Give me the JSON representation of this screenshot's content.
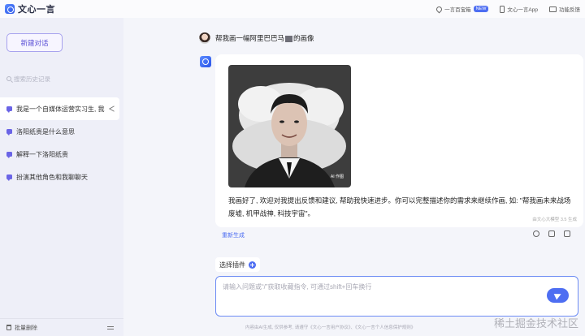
{
  "app": {
    "brand": "文心一言",
    "top_links": [
      {
        "label": "一言百宝箱",
        "badge": "NEW"
      },
      {
        "label": "文心一言App"
      },
      {
        "label": "功能反馈"
      }
    ]
  },
  "sidebar": {
    "new_chat_label": "新建对话",
    "search_placeholder": "搜索历史记录",
    "items": [
      {
        "label": "我是一个自媒体运营实习生, 我"
      },
      {
        "label": "洛阳纸贵是什么意思"
      },
      {
        "label": "解释一下洛阳纸贵"
      },
      {
        "label": "扮演其他角色和我聊聊天"
      }
    ],
    "bulk_delete_label": "批量删除"
  },
  "conversation": {
    "user_prompt_before": "帮我画一幅阿里巴巴马",
    "user_prompt_after": "的画像",
    "image_tag": "AI 作图",
    "reply_text": "我画好了, 欢迎对我提出反馈和建议, 帮助我快速进步。你可以完整描述你的需求来继续作画, 如: \"帮我画未来战场废墟, 机甲战神, 科技宇宙\"。",
    "card_footer": "由文心大模型 3.5 生成",
    "regenerate_label": "重新生成"
  },
  "composer": {
    "plugin_label": "选择插件",
    "placeholder": "请输入问题或“/”获取收藏指令, 可通过shift+回车换行"
  },
  "footer": {
    "disclaimer": "内容由AI生成, 仅供参考, 请遵守《文心一言用户协议》、《文心一言个人信息保护规则》",
    "watermark": "稀土掘金技术社区"
  },
  "colors": {
    "accent": "#4e6ef2",
    "sidebar_bg": "#eeeff8",
    "main_bg": "#f4f5fa"
  }
}
